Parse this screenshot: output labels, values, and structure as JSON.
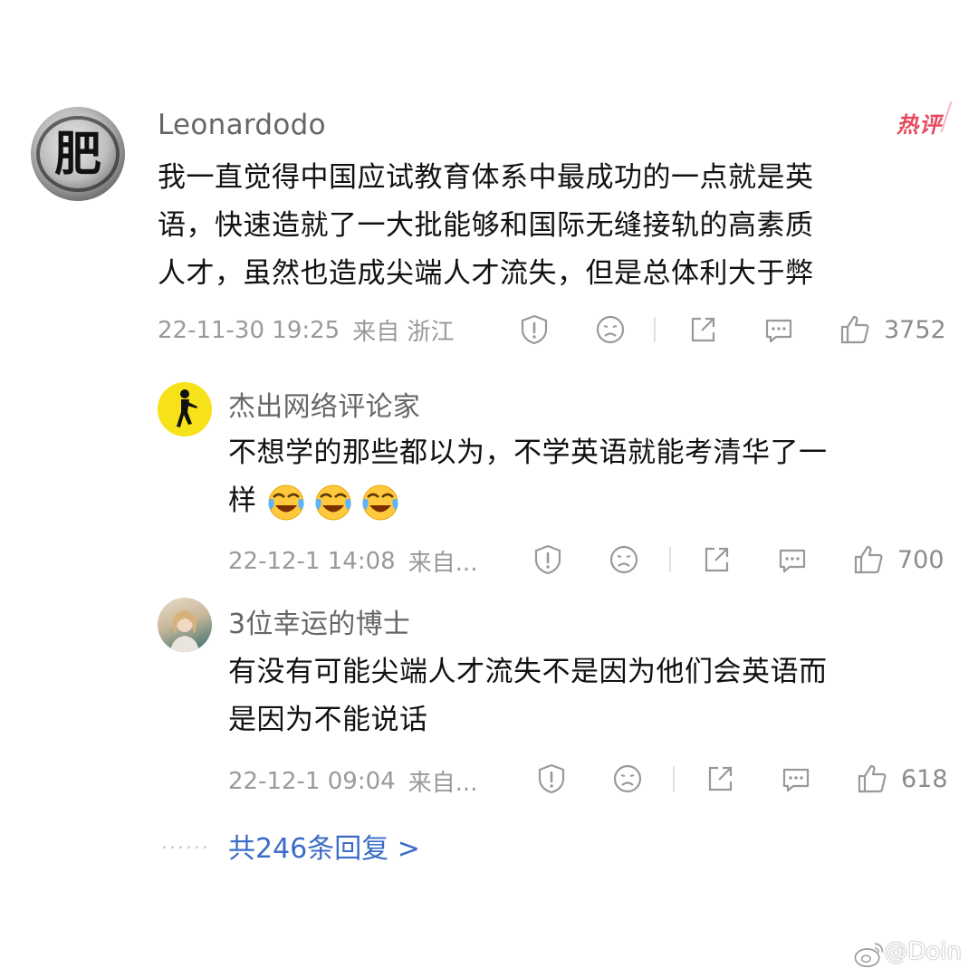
{
  "main_comment": {
    "username": "Leonardodo",
    "hot_badge": "热评",
    "avatar_char": "肥",
    "lines": [
      "我一直觉得中国应试教育体系中最成功的一点就是英",
      "语，快速造就了一大批能够和国际无缝接轨的高素质",
      "人才，虽然也造成尖端人才流失，但是总体利大于弊"
    ],
    "timestamp": "22-11-30 19:25",
    "source": "来自 浙江",
    "likes": "3752"
  },
  "replies": [
    {
      "username": "杰出网络评论家",
      "lines": [
        "不想学的那些都以为，不学英语就能考清华了一",
        "样"
      ],
      "timestamp": "22-12-1 14:08",
      "source": "来自...",
      "likes": "700"
    },
    {
      "username": "3位幸运的博士",
      "lines": [
        "有没有可能尖端人才流失不是因为他们会英语而",
        "是因为不能说话"
      ],
      "timestamp": "22-12-1 09:04",
      "source": "来自...",
      "likes": "618"
    }
  ],
  "more_replies": {
    "dots": "......",
    "label": "共246条回复 >"
  },
  "watermark": "@Doin",
  "icons": [
    "report-icon",
    "dislike-icon",
    "share-icon",
    "comment-icon",
    "like-icon",
    "crying-laugh-emoji",
    "weibo-icon"
  ],
  "colors": {
    "link": "#3b6cc8",
    "hot": "#e84a5f",
    "meta": "#9a9a9a"
  }
}
